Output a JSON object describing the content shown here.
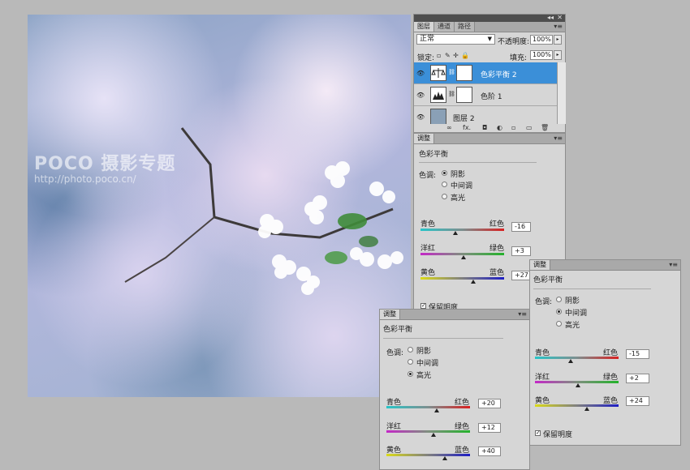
{
  "watermark": {
    "title": "POCO 摄影专题",
    "url": "http://photo.poco.cn/"
  },
  "layers_panel": {
    "tabs": [
      "图层",
      "通道",
      "路径"
    ],
    "blend_mode": "正常",
    "opacity_label": "不透明度:",
    "opacity_value": "100%",
    "lock_label": "锁定:",
    "fill_label": "填充:",
    "fill_value": "100%",
    "layers": [
      {
        "name": "色彩平衡 2",
        "selected": true
      },
      {
        "name": "色阶 1",
        "selected": false
      },
      {
        "name": "图层 2",
        "selected": false
      }
    ],
    "bottom_icons": [
      "∞",
      "fx.",
      "◘",
      "◐",
      "▫",
      "▭",
      "🗑"
    ]
  },
  "adjust_panel_1": {
    "tab": "调整",
    "title": "色彩平衡",
    "tone_label": "色调:",
    "tones": [
      "阴影",
      "中间调",
      "高光"
    ],
    "selected_tone": 0,
    "sliders": [
      {
        "left": "青色",
        "right": "红色",
        "value": "-16",
        "level": -16
      },
      {
        "left": "洋红",
        "right": "绿色",
        "value": "+3",
        "level": 3
      },
      {
        "left": "黄色",
        "right": "蓝色",
        "value": "+27",
        "level": 27
      }
    ],
    "preserve_label": "保留明度"
  },
  "adjust_panel_2": {
    "tab": "调整",
    "title": "色彩平衡",
    "tone_label": "色调:",
    "tones": [
      "阴影",
      "中间调",
      "高光"
    ],
    "selected_tone": 1,
    "sliders": [
      {
        "left": "青色",
        "right": "红色",
        "value": "-15",
        "level": -15
      },
      {
        "left": "洋红",
        "right": "绿色",
        "value": "+2",
        "level": 2
      },
      {
        "left": "黄色",
        "right": "蓝色",
        "value": "+24",
        "level": 24
      }
    ],
    "preserve_label": "保留明度",
    "preserve_checked": true
  },
  "adjust_panel_3": {
    "tab": "调整",
    "title": "色彩平衡",
    "tone_label": "色调:",
    "tones": [
      "阴影",
      "中间调",
      "高光"
    ],
    "selected_tone": 2,
    "sliders": [
      {
        "left": "青色",
        "right": "红色",
        "value": "+20",
        "level": 20
      },
      {
        "left": "洋红",
        "right": "绿色",
        "value": "+12",
        "level": 12
      },
      {
        "left": "黄色",
        "right": "蓝色",
        "value": "+40",
        "level": 40
      }
    ]
  }
}
